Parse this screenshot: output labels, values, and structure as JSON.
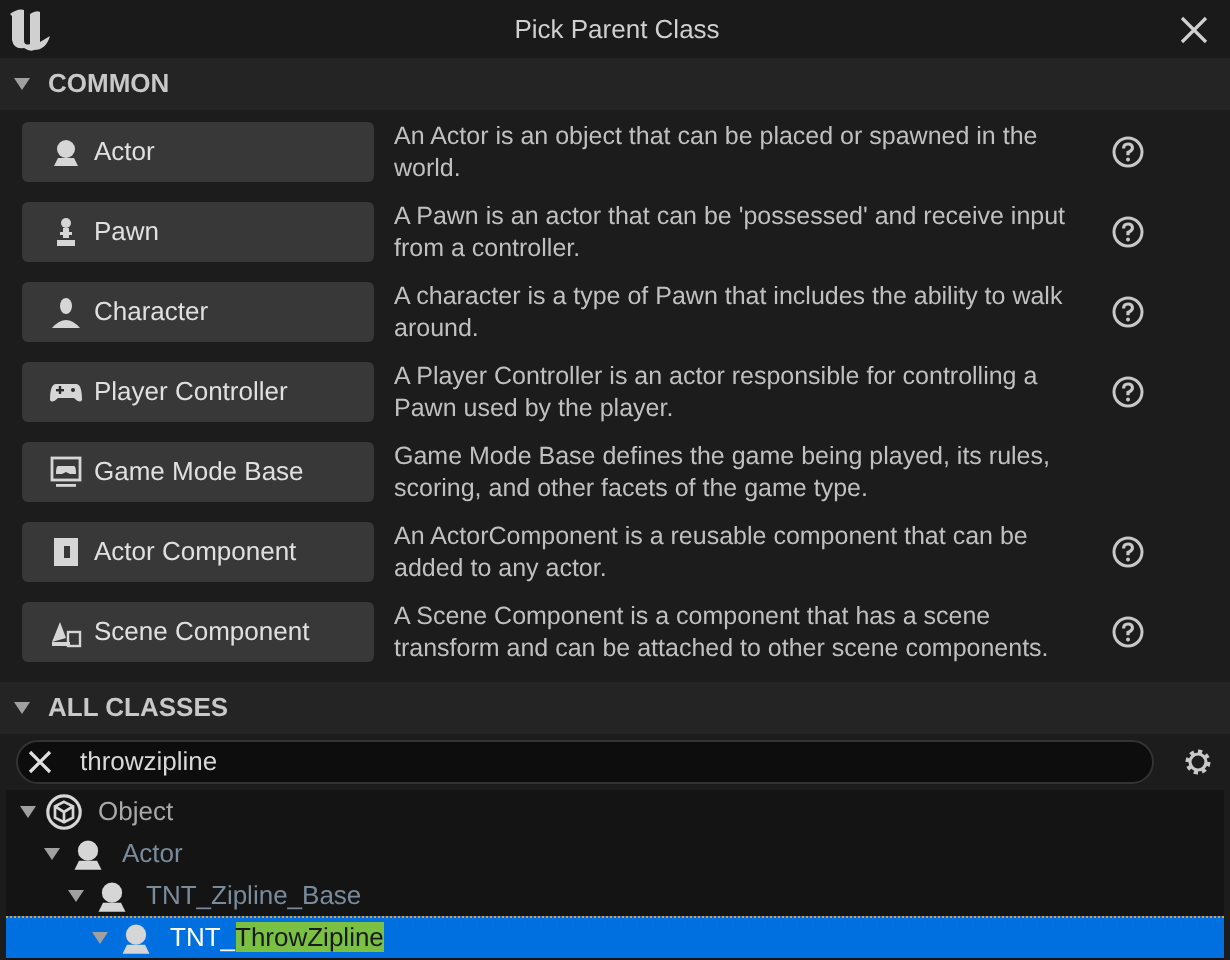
{
  "window": {
    "title": "Pick Parent Class"
  },
  "common": {
    "title": "COMMON",
    "expanded": true,
    "items": [
      {
        "kind": "actor",
        "label": "Actor",
        "description": "An Actor is an object that can be placed or spawned in the world.",
        "help": true
      },
      {
        "kind": "pawn",
        "label": "Pawn",
        "description": "A Pawn is an actor that can be 'possessed' and receive input from a controller.",
        "help": true
      },
      {
        "kind": "character",
        "label": "Character",
        "description": "A character is a type of Pawn that includes the ability to walk around.",
        "help": true
      },
      {
        "kind": "controller",
        "label": "Player Controller",
        "description": "A Player Controller is an actor responsible for controlling a Pawn used by the player.",
        "help": true
      },
      {
        "kind": "gamemode",
        "label": "Game Mode Base",
        "description": "Game Mode Base defines the game being played, its rules, scoring, and other facets of the game type.",
        "help": false
      },
      {
        "kind": "component",
        "label": "Actor Component",
        "description": "An ActorComponent is a reusable component that can be added to any actor.",
        "help": true
      },
      {
        "kind": "scene",
        "label": "Scene Component",
        "description": "A Scene Component is a component that has a scene transform and can be attached to other scene components.",
        "help": true
      }
    ]
  },
  "all_classes": {
    "title": "ALL CLASSES",
    "expanded": true,
    "search": {
      "value": "throwzipline"
    },
    "tree": [
      {
        "kind": "object",
        "label": "Object",
        "expanded": true,
        "dimmed": false,
        "selected": false,
        "children": [
          {
            "kind": "actor",
            "label": "Actor",
            "expanded": true,
            "dimmed": true,
            "selected": false,
            "children": [
              {
                "kind": "actor",
                "label": "TNT_Zipline_Base",
                "expanded": true,
                "dimmed": true,
                "selected": false,
                "children": [
                  {
                    "kind": "actor",
                    "label": "TNT_",
                    "match": "ThrowZipline",
                    "expanded": true,
                    "selected": true
                  }
                ]
              }
            ]
          }
        ]
      }
    ]
  }
}
